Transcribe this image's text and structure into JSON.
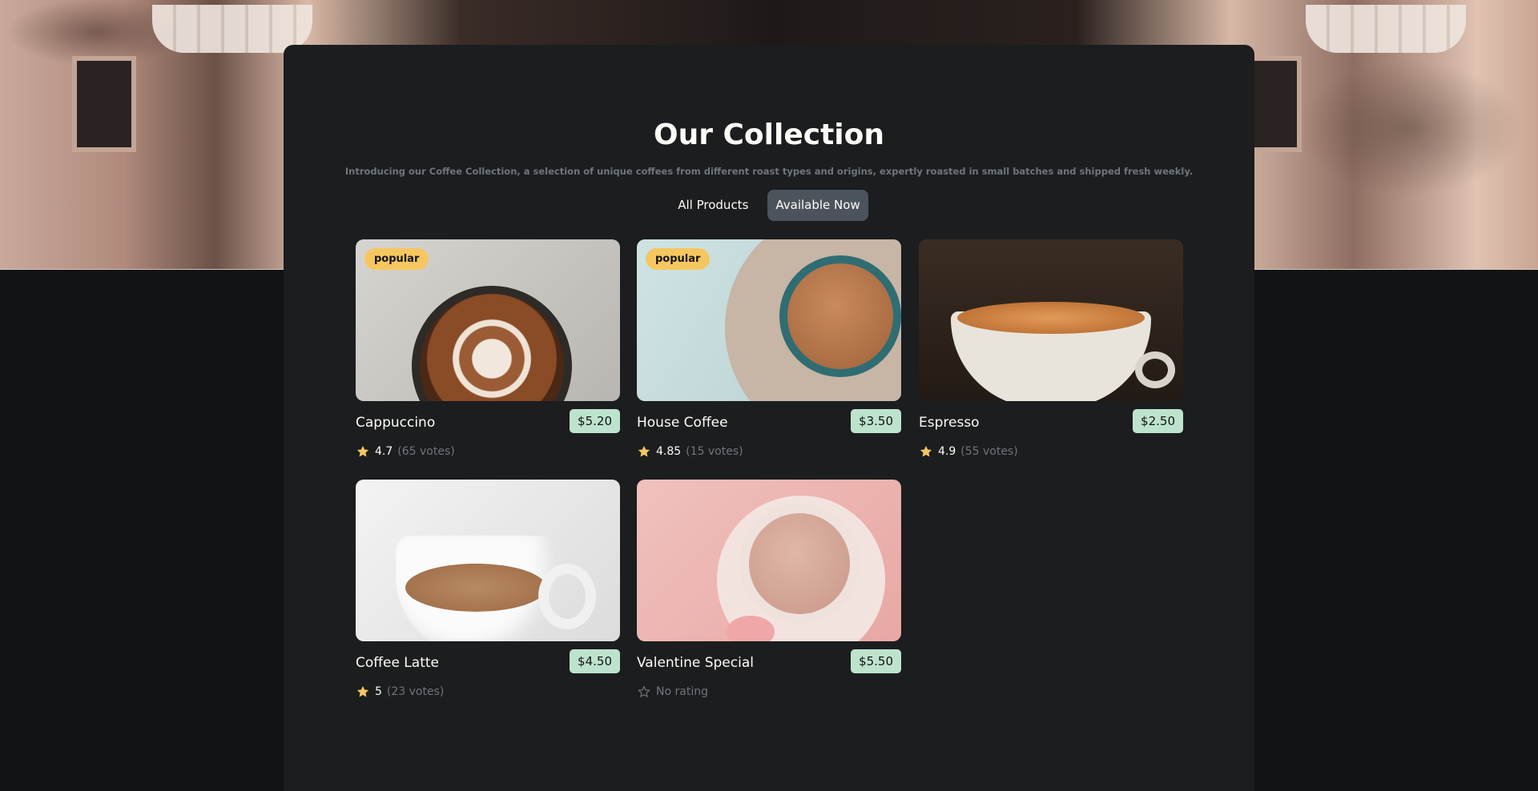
{
  "header": {
    "title": "Our Collection",
    "subtitle": "Introducing our Coffee Collection, a selection of unique coffees from different roast types and origins, expertly roasted in small batches and shipped fresh weekly."
  },
  "tabs": [
    {
      "label": "All Products",
      "active": false
    },
    {
      "label": "Available Now",
      "active": true
    }
  ],
  "products": [
    {
      "name": "Cappuccino",
      "price": "$5.20",
      "badge": "popular",
      "rating": "4.7",
      "votes": "(65 votes)",
      "rated": true
    },
    {
      "name": "House Coffee",
      "price": "$3.50",
      "badge": "popular",
      "rating": "4.85",
      "votes": "(15 votes)",
      "rated": true
    },
    {
      "name": "Espresso",
      "price": "$2.50",
      "badge": "",
      "rating": "4.9",
      "votes": "(55 votes)",
      "rated": true
    },
    {
      "name": "Coffee Latte",
      "price": "$4.50",
      "badge": "",
      "rating": "5",
      "votes": "(23 votes)",
      "rated": true
    },
    {
      "name": "Valentine Special",
      "price": "$5.50",
      "badge": "",
      "rating": "",
      "votes": "",
      "rated": false,
      "no_rating_label": "No rating"
    }
  ],
  "colors": {
    "badge": "#f6c760",
    "price": "#bee3cc",
    "active_tab": "#4b535c",
    "star": "#f6c760"
  }
}
